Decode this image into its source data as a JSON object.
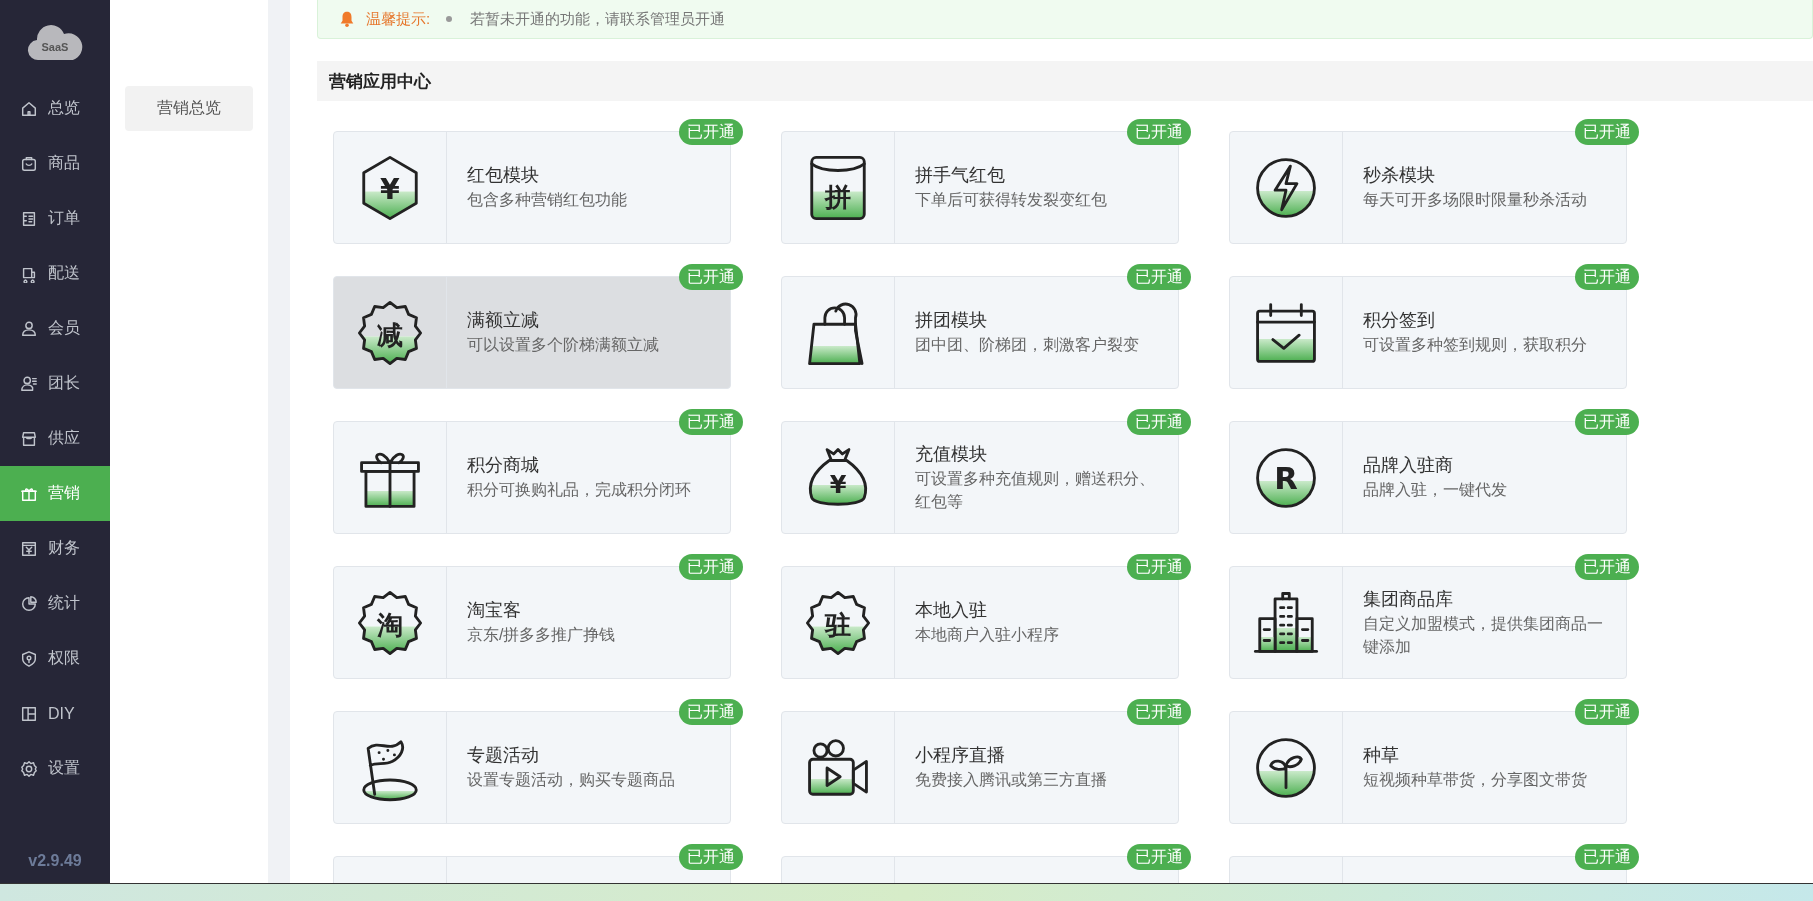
{
  "sidebar": {
    "logo_text": "SaaS",
    "items": [
      {
        "label": "总览",
        "selected": false
      },
      {
        "label": "商品",
        "selected": false
      },
      {
        "label": "订单",
        "selected": false
      },
      {
        "label": "配送",
        "selected": false
      },
      {
        "label": "会员",
        "selected": false
      },
      {
        "label": "团长",
        "selected": false
      },
      {
        "label": "供应",
        "selected": false
      },
      {
        "label": "营销",
        "selected": true
      },
      {
        "label": "财务",
        "selected": false
      },
      {
        "label": "统计",
        "selected": false
      },
      {
        "label": "权限",
        "selected": false
      },
      {
        "label": "DIY",
        "selected": false
      },
      {
        "label": "设置",
        "selected": false
      }
    ],
    "version": "v2.9.49"
  },
  "subnav": {
    "items": [
      {
        "label": "营销总览",
        "selected": false
      }
    ]
  },
  "notice": {
    "title": "温馨提示:",
    "items": [
      "若暂未开通的功能，请联系管理员开通"
    ]
  },
  "section": {
    "title": "营销应用中心"
  },
  "cards": [
    {
      "title": "红包模块",
      "description": "包含多种营销红包功能",
      "badge": "已开通",
      "icon_text": "¥",
      "highlighted": false
    },
    {
      "title": "拼手气红包",
      "description": "下单后可获得转发裂变红包",
      "badge": "已开通",
      "icon_text": "拼",
      "highlighted": false
    },
    {
      "title": "秒杀模块",
      "description": "每天可开多场限时限量秒杀活动",
      "badge": "已开通",
      "highlighted": false
    },
    {
      "title": "满额立减",
      "description": "可以设置多个阶梯满额立减",
      "badge": "已开通",
      "icon_text": "减",
      "highlighted": true
    },
    {
      "title": "拼团模块",
      "description": "团中团、阶梯团，刺激客户裂变",
      "badge": "已开通",
      "highlighted": false
    },
    {
      "title": "积分签到",
      "description": "可设置多种签到规则，获取积分",
      "badge": "已开通",
      "highlighted": false
    },
    {
      "title": "积分商城",
      "description": "积分可换购礼品，完成积分闭环",
      "badge": "已开通",
      "highlighted": false
    },
    {
      "title": "充值模块",
      "description": "可设置多种充值规则，赠送积分、红包等",
      "badge": "已开通",
      "icon_text": "¥",
      "highlighted": false
    },
    {
      "title": "品牌入驻商",
      "description": "品牌入驻，一键代发",
      "badge": "已开通",
      "icon_text": "R",
      "highlighted": false
    },
    {
      "title": "淘宝客",
      "description": "京东/拼多多推广挣钱",
      "badge": "已开通",
      "icon_text": "淘",
      "highlighted": false
    },
    {
      "title": "本地入驻",
      "description": "本地商户入驻小程序",
      "badge": "已开通",
      "icon_text": "驻",
      "highlighted": false
    },
    {
      "title": "集团商品库",
      "description": "自定义加盟模式，提供集团商品一键添加",
      "badge": "已开通",
      "highlighted": false
    },
    {
      "title": "专题活动",
      "description": "设置专题活动，购买专题商品",
      "badge": "已开通",
      "highlighted": false
    },
    {
      "title": "小程序直播",
      "description": "免费接入腾讯或第三方直播",
      "badge": "已开通",
      "highlighted": false
    },
    {
      "title": "种草",
      "description": "短视频种草带货，分享图文带货",
      "badge": "已开通",
      "highlighted": false
    },
    {
      "badge": "已开通",
      "highlighted": false
    },
    {
      "badge": "已开通",
      "highlighted": false
    },
    {
      "badge": "已开通",
      "highlighted": false
    }
  ]
}
